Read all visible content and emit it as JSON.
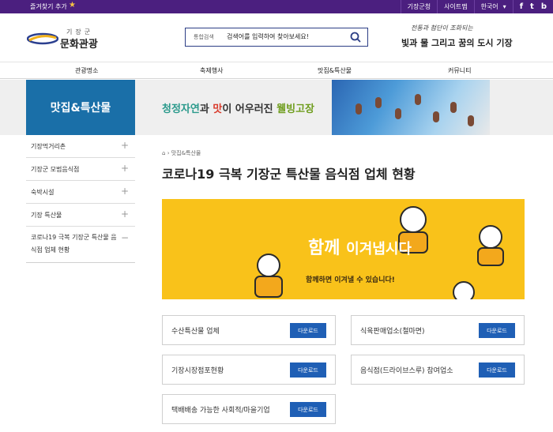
{
  "topbar": {
    "favorite": "즐겨찾기 추가",
    "links": [
      "기장군청",
      "사이트맵"
    ],
    "language": "한국어",
    "sns": [
      "f",
      "t",
      "b"
    ]
  },
  "header": {
    "logo_top": "기장군",
    "logo_main": "문화관광",
    "search_label": "통합검색",
    "search_placeholder": "검색어를 입력하여 찾아보세요!",
    "slogan_top": "전통과 첨단이 조화되는",
    "slogan_main": "빛과 물 그리고 꿈의 도시 기장"
  },
  "nav": [
    "관광명소",
    "축제행사",
    "맛집&특산물",
    "커뮤니티"
  ],
  "banner": {
    "section_title": "맛집&특산물",
    "slogan_part1": "청정자연",
    "slogan_part2": "과 ",
    "slogan_part3": "맛",
    "slogan_part4": "이 어우러진 ",
    "slogan_part5": "웰빙고장"
  },
  "sidebar": {
    "items": [
      {
        "label": "기장먹거리촌",
        "sign": "+"
      },
      {
        "label": "기장군 모범음식점",
        "sign": "+"
      },
      {
        "label": "숙박시설",
        "sign": "+"
      },
      {
        "label": "기장 특산물",
        "sign": "+"
      },
      {
        "label": "코로나19 극복 기장군 특산물 음식점 업체 현황",
        "sign": "−"
      }
    ]
  },
  "breadcrumb": "맛집&특산물",
  "page_title": "코로나19 극복 기장군 특산물 음식점 업체 현황",
  "hero": {
    "headline1": "함께 ",
    "headline2": "이겨냅시다",
    "sub": "함께하면 이겨낼 수 있습니다!"
  },
  "download_label": "다운로드",
  "cards": [
    {
      "name": "수산특산물 업체"
    },
    {
      "name": "식육판매업소(철마면)"
    },
    {
      "name": "기장시장점포현황"
    },
    {
      "name": "음식점(드라이브스루) 참여업소"
    },
    {
      "name": "택배배송 가능한 사회적/마을기업"
    }
  ],
  "colors": {
    "topbar": "#4b1f7f",
    "section_blue": "#1a6fa8",
    "hero_yellow": "#f9c21a",
    "button_blue": "#1f5fb5"
  }
}
